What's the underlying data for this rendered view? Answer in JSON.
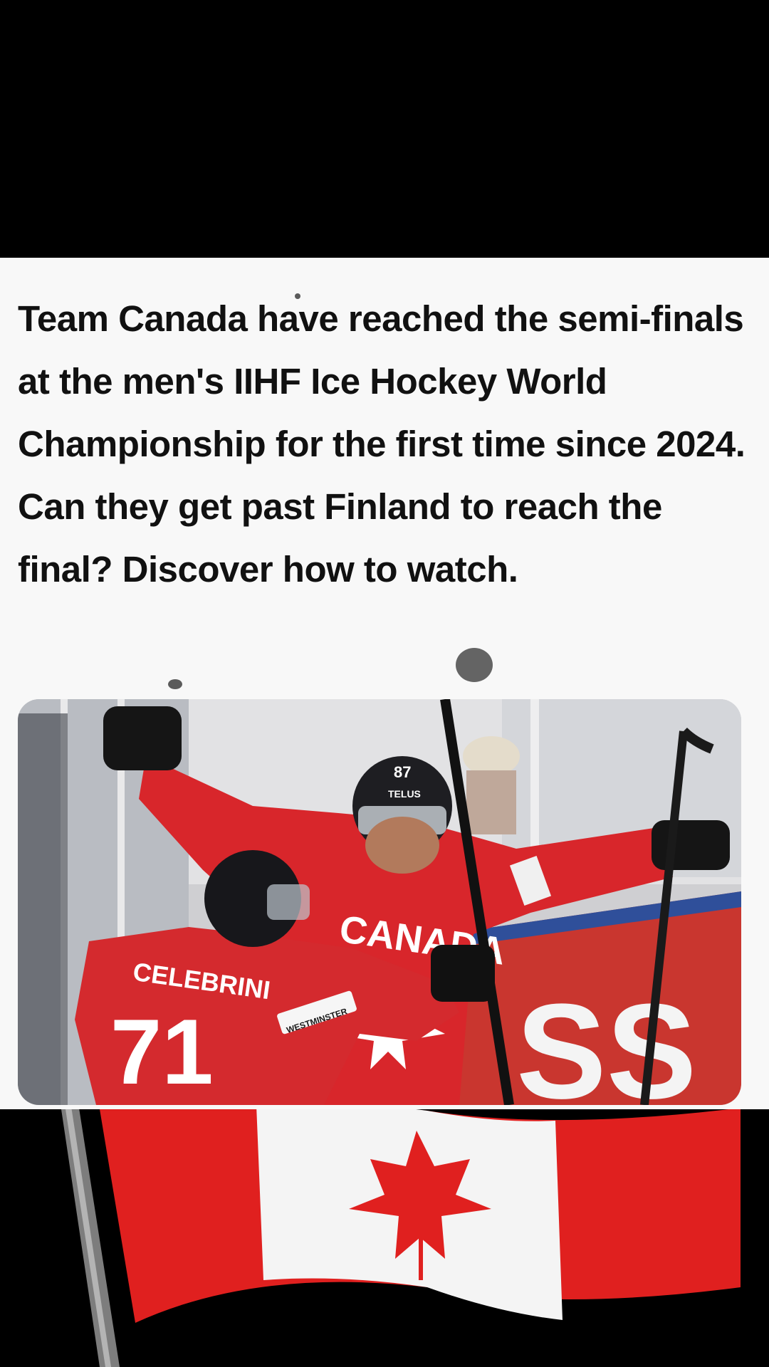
{
  "post": {
    "headline": "Team Canada have reached the semi-finals at the men's IIHF Ice Hockey World Championship for the first time since 2024. Can they get past Finland to reach the final? Discover how to watch."
  },
  "photo": {
    "jersey_word": "CANADA",
    "player_name": "CELEBRINI",
    "player_number": "71",
    "other_number": "87",
    "helmet_sponsor": "TELUS",
    "shoulder_sponsor": "WESTMINSTER",
    "board_text": "SS"
  },
  "colors": {
    "jersey_red": "#d8262b",
    "flag_red": "#e0201f",
    "card_bg": "#f8f8f8"
  }
}
